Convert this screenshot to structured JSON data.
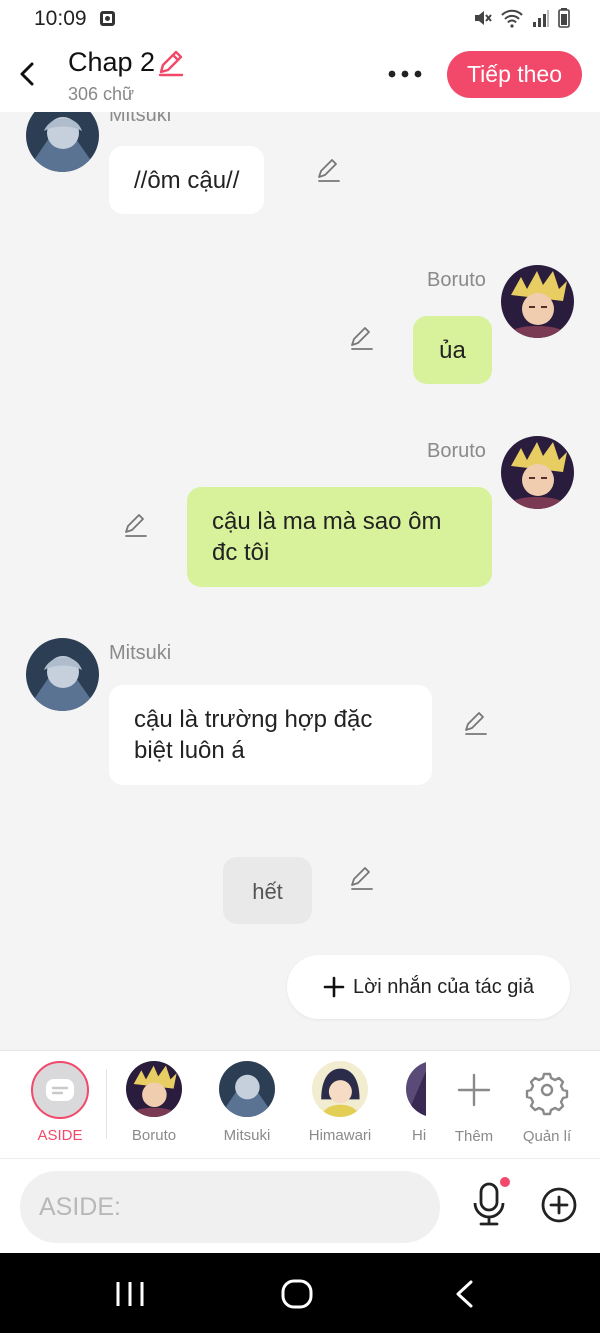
{
  "status_bar": {
    "time": "10:09"
  },
  "header": {
    "title": "Chap 2",
    "word_count": "306 chữ",
    "next_button": "Tiếp theo"
  },
  "messages": [
    {
      "sender": "Mitsuki",
      "side": "left",
      "text": "//ôm cậu//"
    },
    {
      "sender": "Boruto",
      "side": "right",
      "text": "ủa"
    },
    {
      "sender": "Boruto",
      "side": "right",
      "text": "cậu là ma mà sao ôm đc tôi"
    },
    {
      "sender": "Mitsuki",
      "side": "left",
      "text": "cậu là trường hợp đặc biệt luôn á"
    },
    {
      "sender": "",
      "side": "center",
      "text": "hết"
    }
  ],
  "author_note_button": "Lời nhắn của tác giả",
  "characters": {
    "aside": "ASIDE",
    "list": [
      "Boruto",
      "Mitsuki",
      "Himawari",
      "Hi"
    ],
    "add": "Thêm",
    "manage": "Quản lí"
  },
  "input": {
    "placeholder": "ASIDE:"
  },
  "colors": {
    "accent": "#f2486a",
    "bubble_green": "#d7f29a",
    "bubble_white": "#ffffff",
    "background": "#f4f4f5"
  }
}
